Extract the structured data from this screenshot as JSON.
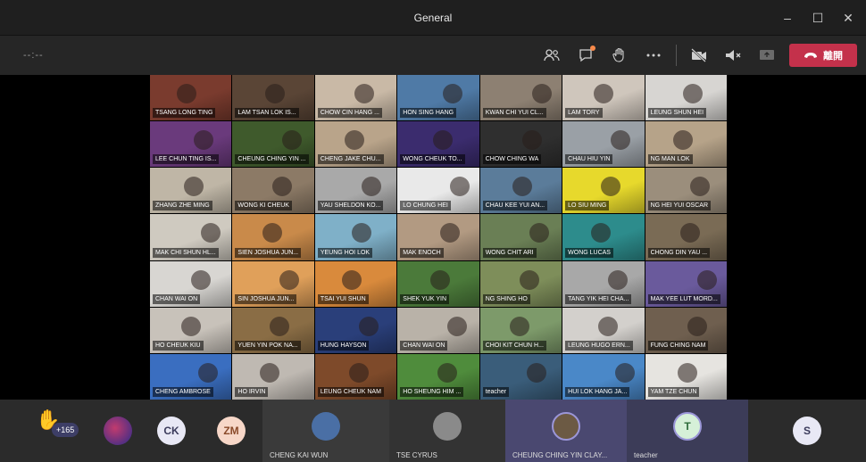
{
  "window": {
    "title": "General",
    "minimize_glyph": "–",
    "maximize_glyph": "☐",
    "close_glyph": "✕"
  },
  "toolbar": {
    "timer": "--:--",
    "hangup_label": "離開",
    "icons": [
      "people-icon",
      "chat-icon",
      "raise-hand-icon",
      "more-icon",
      "camera-off-icon",
      "mic-muted-icon",
      "share-tray-icon"
    ],
    "hangup_color": "#c4314b"
  },
  "participants": [
    {
      "name": "TSANG LONG TING",
      "bg": "#7a3b2e"
    },
    {
      "name": "LAM TSAN LOK IS...",
      "bg": "#5a4536"
    },
    {
      "name": "CHOW CIN HANG ...",
      "bg": "#c9b9a6"
    },
    {
      "name": "HON SING HANG",
      "bg": "#4f7aa6"
    },
    {
      "name": "KWAN CHI YUI CL...",
      "bg": "#8d8072"
    },
    {
      "name": "LAM TORY",
      "bg": "#cfc6bc"
    },
    {
      "name": "LEUNG SHUN HEI",
      "bg": "#d7d5d2"
    },
    {
      "name": "LEE CHUN TING IS...",
      "bg": "#6a3a7c"
    },
    {
      "name": "CHEUNG CHING YIN ...",
      "bg": "#3f5a2c"
    },
    {
      "name": "CHENG JAKE CHU...",
      "bg": "#b9a48a"
    },
    {
      "name": "WONG CHEUK TO...",
      "bg": "#3b2c6e"
    },
    {
      "name": "CHOW CHING WA",
      "bg": "#2f2f2f"
    },
    {
      "name": "CHAU HIU YIN",
      "bg": "#9aa0a6"
    },
    {
      "name": "NG MAN LOK",
      "bg": "#b6a389"
    },
    {
      "name": "ZHANG ZHE MING",
      "bg": "#bfb6a6"
    },
    {
      "name": "WONG KI CHEUK",
      "bg": "#8c7a66"
    },
    {
      "name": "YAU SHELDON KO...",
      "bg": "#a9a9a9"
    },
    {
      "name": "LO CHUNG HEI",
      "bg": "#e9e9e9"
    },
    {
      "name": "CHAU KEE YUI AN...",
      "bg": "#5b7c9a"
    },
    {
      "name": "LO SIU MING",
      "bg": "#e7d92c"
    },
    {
      "name": "NG HEI YUI OSCAR",
      "bg": "#9b8e7c"
    },
    {
      "name": "MAK CHI SHUN HL...",
      "bg": "#cfcac0"
    },
    {
      "name": "SIEN JOSHUA JUN...",
      "bg": "#c98a4a"
    },
    {
      "name": "YEUNG HOI LOK",
      "bg": "#7fb0c8"
    },
    {
      "name": "MAK ENOCH",
      "bg": "#b29a82"
    },
    {
      "name": "WONG CHIT ARI",
      "bg": "#6a7f55"
    },
    {
      "name": "WONG LUCAS",
      "bg": "#2d8c8c"
    },
    {
      "name": "CHONG DIN YAU ...",
      "bg": "#7a6b55"
    },
    {
      "name": "CHAN WAI ON",
      "bg": "#d8d6d2"
    },
    {
      "name": "SIN JOSHUA JUN...",
      "bg": "#e0a05a"
    },
    {
      "name": "TSAI YUI SHUN",
      "bg": "#d98a3c"
    },
    {
      "name": "SHEK YUK YIN",
      "bg": "#4b7a3a"
    },
    {
      "name": "NG SHING HO",
      "bg": "#7e8e5a"
    },
    {
      "name": "TANG YIK HEI CHA...",
      "bg": "#a8a8a8"
    },
    {
      "name": "MAK YEE LUT MORD...",
      "bg": "#6a5a9c"
    },
    {
      "name": "HO CHEUK KIU",
      "bg": "#c8c2ba"
    },
    {
      "name": "YUEN YIN POK NA...",
      "bg": "#8a6d45"
    },
    {
      "name": "HUNG HAYSON",
      "bg": "#2a3f7a"
    },
    {
      "name": "CHAN WAI ON",
      "bg": "#b9b2a8"
    },
    {
      "name": "CHOI KIT CHUN H...",
      "bg": "#7d9a6a"
    },
    {
      "name": "LEUNG HUGO ERN...",
      "bg": "#d3d0cc"
    },
    {
      "name": "FUNG CHING NAM",
      "bg": "#6f5f4f"
    },
    {
      "name": "CHENG AMBROSE",
      "bg": "#3a6ec0"
    },
    {
      "name": "HO IRVIN",
      "bg": "#bfb9b2"
    },
    {
      "name": "LEUNG CHEUK NAM",
      "bg": "#7e4a2a"
    },
    {
      "name": "HO SHEUNG HIM ...",
      "bg": "#4f8c3c"
    },
    {
      "name": "teacher",
      "bg": "#3a5d7a"
    },
    {
      "name": "HUI LOK HANG JA...",
      "bg": "#4a88c8"
    },
    {
      "name": "YAM TZE CHUN",
      "bg": "#e6e4e0"
    }
  ],
  "footer": {
    "overflow_count": "+165",
    "items": [
      {
        "type": "initials",
        "label": "CK",
        "color": "#e8e8f5",
        "text_color": "#3b3b5c"
      },
      {
        "type": "initials",
        "label": "ZM",
        "color": "#f7d7c8",
        "text_color": "#8a4a2a"
      },
      {
        "type": "video",
        "label": "CHENG KAI WUN",
        "color": "#4a6fa5"
      },
      {
        "type": "video",
        "label": "TSE CYRUS",
        "color": "#6b6b6b"
      },
      {
        "type": "video",
        "label": "CHEUNG CHING YIN CLAY...",
        "color": "#5a4f7a"
      },
      {
        "type": "initials",
        "label": "T",
        "name": "teacher",
        "color": "#d6f0d8",
        "text_color": "#2e6b3a"
      },
      {
        "type": "initials",
        "label": "S",
        "color": "#e8e8f5",
        "text_color": "#3b3b5c"
      }
    ]
  }
}
